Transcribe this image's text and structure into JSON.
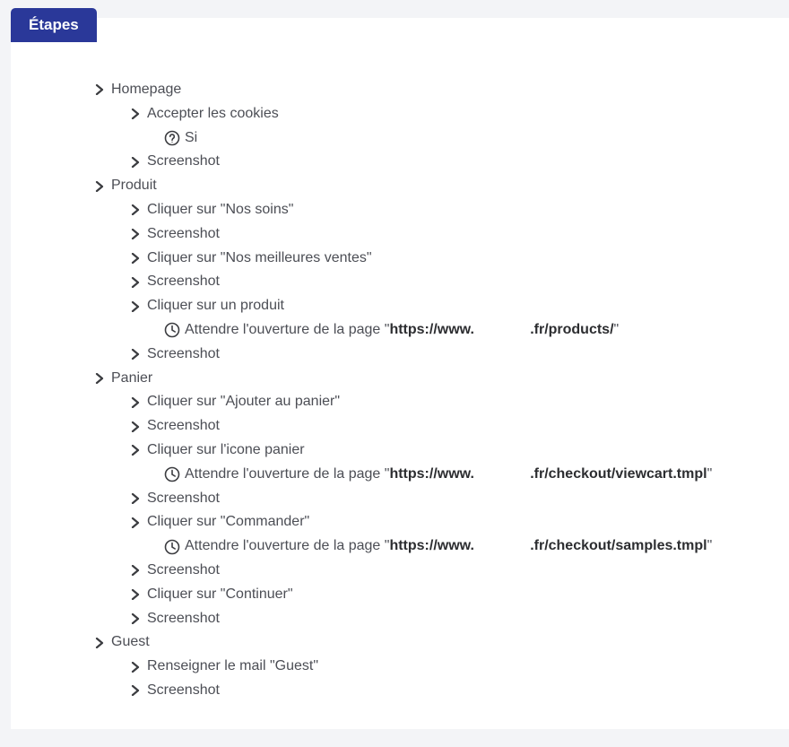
{
  "tab_label": "Étapes",
  "wait_prefix": "Attendre l'ouverture de la page \"",
  "wait_url_1": "https://www.",
  "wait_url_2_products": ".fr/products/",
  "wait_url_2_viewcart": ".fr/checkout/viewcart.tmpl",
  "wait_url_2_samples": ".fr/checkout/samples.tmpl",
  "wait_suffix": "\"",
  "url_gap": "              ",
  "tree": {
    "homepage": {
      "label": "Homepage",
      "accept_cookies": "Accepter les cookies",
      "si": "Si",
      "screenshot": "Screenshot"
    },
    "produit": {
      "label": "Produit",
      "click_nos_soins": "Cliquer sur \"Nos soins\"",
      "screenshot1": "Screenshot",
      "click_meilleures": "Cliquer sur \"Nos meilleures ventes\"",
      "screenshot2": "Screenshot",
      "click_produit": "Cliquer sur un produit",
      "screenshot3": "Screenshot"
    },
    "panier": {
      "label": "Panier",
      "click_ajouter": "Cliquer sur \"Ajouter au panier\"",
      "screenshot1": "Screenshot",
      "click_icone": "Cliquer sur l'icone panier",
      "screenshot2": "Screenshot",
      "click_commander": "Cliquer sur \"Commander\"",
      "screenshot3": "Screenshot",
      "click_continuer": "Cliquer sur \"Continuer\"",
      "screenshot4": "Screenshot"
    },
    "guest": {
      "label": "Guest",
      "renseigner": "Renseigner le mail \"Guest\"",
      "screenshot": "Screenshot"
    }
  }
}
